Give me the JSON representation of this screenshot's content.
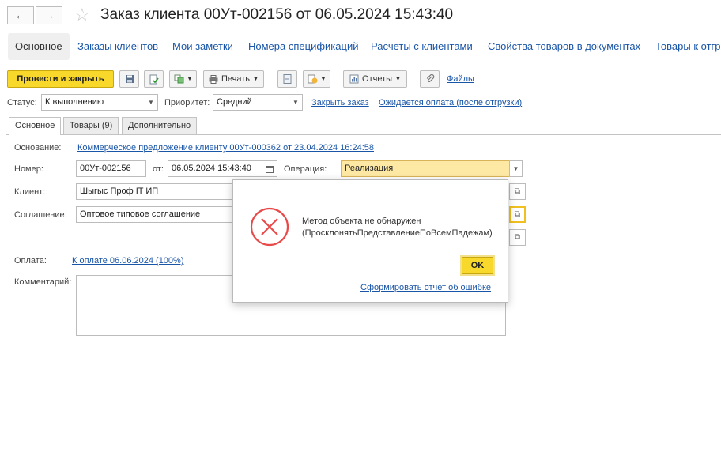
{
  "window": {
    "title": "Заказ клиента 00Ут-002156 от 06.05.2024 15:43:40"
  },
  "nav": {
    "back_icon": "←",
    "forward_icon": "→",
    "favorite_icon": "☆"
  },
  "sections": [
    "Основное",
    "Заказы клиентов",
    "Мои заметки",
    "Номера спецификаций",
    "Расчеты с клиентами",
    "Свойства товаров в документах",
    "Товары к отгр"
  ],
  "toolbar": {
    "post_close": "Провести и закрыть",
    "print": "Печать",
    "reports": "Отчеты",
    "files": "Файлы"
  },
  "status_row": {
    "status_label": "Статус:",
    "status_value": "К выполнению",
    "priority_label": "Приоритет:",
    "priority_value": "Средний",
    "close_order": "Закрыть заказ",
    "awaiting": "Ожидается оплата (после отгрузки)"
  },
  "form_tabs": [
    "Основное",
    "Товары (9)",
    "Дополнительно"
  ],
  "form": {
    "basis_label": "Основание:",
    "basis_value": "Коммерческое предложение клиенту 00Ут-000362 от 23.04.2024 16:24:58",
    "number_label": "Номер:",
    "number_value": "00Ут-002156",
    "from_label": "от:",
    "date_value": "06.05.2024 15:43:40",
    "operation_label": "Операция:",
    "operation_value": "Реализация",
    "client_label": "Клиент:",
    "client_value": "Шыгыс Проф IT ИП",
    "agreement_label": "Соглашение:",
    "agreement_value": "Оптовое типовое соглашение",
    "payment_label": "Оплата:",
    "payment_value": "К оплате 06.06.2024 (100%)",
    "comment_label": "Комментарий:"
  },
  "dialog": {
    "message_line1": "Метод объекта не обнаружен",
    "message_line2": "(ПросклонятьПредставлениеПоВсемПадежам)",
    "ok": "OK",
    "report_link": "Сформировать отчет об ошибке"
  }
}
